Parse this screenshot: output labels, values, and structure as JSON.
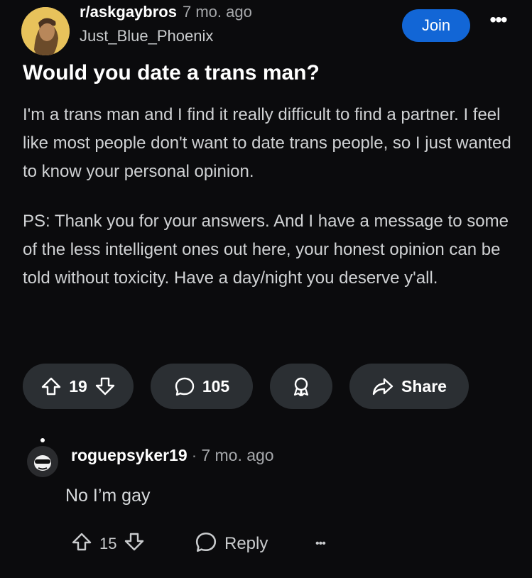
{
  "post": {
    "subreddit": "r/askgaybros",
    "time": "7 mo. ago",
    "author": "Just_Blue_Phoenix",
    "join_label": "Join",
    "more_label": "•••",
    "title": "Would you date a trans man?",
    "body": [
      "I'm a trans man and I find it really difficult to find a partner. I feel like most people don't want to date trans people, so I just wanted to know your personal opinion.",
      "PS: Thank you for your answers. And I have a message to some of the less intelligent ones out here, your honest opinion can be told without toxicity. Have a day/night you deserve y'all."
    ],
    "votes": "19",
    "comments": "105",
    "share_label": "Share"
  },
  "comment": {
    "user": "roguepsyker19",
    "separator": "·",
    "time": "7 mo. ago",
    "text": "No I’m gay",
    "votes": "15",
    "reply_label": "Reply",
    "more_label": "•••"
  },
  "icons": {
    "upvote": "arrow-up-icon",
    "downvote": "arrow-down-icon",
    "comment": "chat-bubble-icon",
    "award": "award-icon",
    "share": "share-arrow-icon"
  },
  "colors": {
    "background": "#0b0b0d",
    "join_button": "#1266d6",
    "pill": "#2b2f33"
  }
}
